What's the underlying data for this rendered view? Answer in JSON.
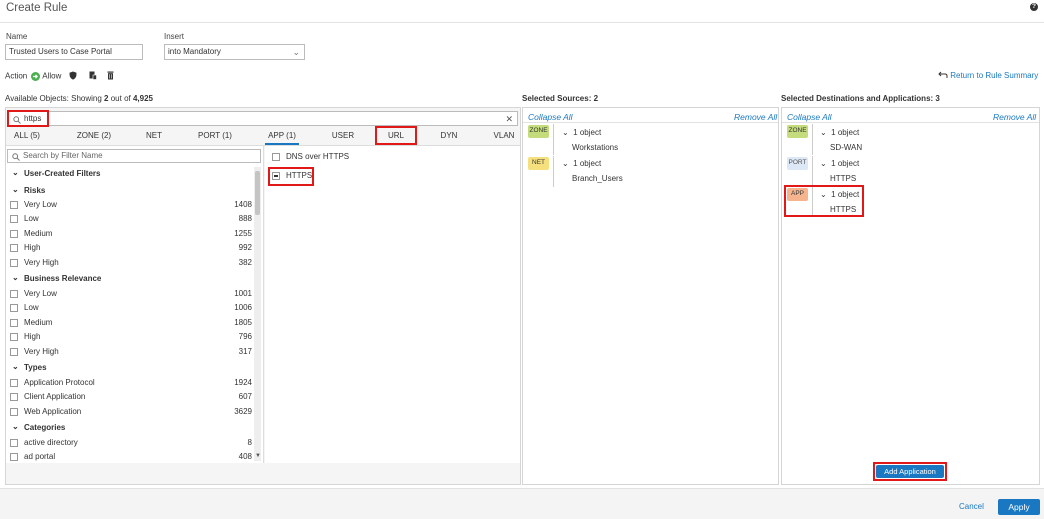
{
  "header": {
    "title": "Create Rule",
    "help_icon": "?"
  },
  "form": {
    "name_label": "Name",
    "name_value": "Trusted Users to Case Portal",
    "insert_label": "Insert",
    "insert_value": "into Mandatory",
    "action_label": "Action",
    "action_value": "Allow",
    "return_link": "Return to Rule Summary"
  },
  "available": {
    "label": "Available Objects: Showing",
    "shown": "2",
    "sep": "out of",
    "total": "4,925",
    "search_value": "https",
    "tabs": [
      "ALL (5)",
      "ZONE (2)",
      "NET",
      "PORT (1)",
      "APP (1)",
      "USER",
      "URL",
      "DYN",
      "VLAN"
    ],
    "filter_placeholder": "Search by Filter Name",
    "filters": {
      "user_created": "User-Created Filters",
      "risks": {
        "title": "Risks",
        "items": [
          {
            "label": "Very Low",
            "count": "1408"
          },
          {
            "label": "Low",
            "count": "888"
          },
          {
            "label": "Medium",
            "count": "1255"
          },
          {
            "label": "High",
            "count": "992"
          },
          {
            "label": "Very High",
            "count": "382"
          }
        ]
      },
      "business": {
        "title": "Business Relevance",
        "items": [
          {
            "label": "Very Low",
            "count": "1001"
          },
          {
            "label": "Low",
            "count": "1006"
          },
          {
            "label": "Medium",
            "count": "1805"
          },
          {
            "label": "High",
            "count": "796"
          },
          {
            "label": "Very High",
            "count": "317"
          }
        ]
      },
      "types": {
        "title": "Types",
        "items": [
          {
            "label": "Application Protocol",
            "count": "1924"
          },
          {
            "label": "Client Application",
            "count": "607"
          },
          {
            "label": "Web Application",
            "count": "3629"
          }
        ]
      },
      "categories": {
        "title": "Categories",
        "items": [
          {
            "label": "active directory",
            "count": "8"
          },
          {
            "label": "ad portal",
            "count": "408"
          }
        ]
      }
    },
    "results": [
      "DNS over HTTPS",
      "HTTPS"
    ]
  },
  "sources": {
    "title": "Selected Sources: 2",
    "collapse": "Collapse All",
    "remove": "Remove All",
    "groups": [
      {
        "badge": "ZONE",
        "summary": "1 object",
        "item": "Workstations"
      },
      {
        "badge": "NET",
        "summary": "1 object",
        "item": "Branch_Users"
      }
    ]
  },
  "destinations": {
    "title": "Selected Destinations and Applications: 3",
    "collapse": "Collapse All",
    "remove": "Remove All",
    "groups": [
      {
        "badge": "ZONE",
        "summary": "1 object",
        "item": "SD-WAN"
      },
      {
        "badge": "PORT",
        "summary": "1 object",
        "item": "HTTPS"
      },
      {
        "badge": "APP",
        "summary": "1 object",
        "item": "HTTPS"
      }
    ],
    "add_button": "Add Application"
  },
  "footer": {
    "cancel": "Cancel",
    "apply": "Apply"
  },
  "colors": {
    "accent": "#1a78c2",
    "highlight": "#e01818",
    "zone": "#c5dc7c",
    "net": "#f6e07e",
    "port": "#dde8f6",
    "app": "#f6b48e"
  },
  "icons": [
    "help-icon",
    "allow-icon",
    "shield-icon",
    "log-icon",
    "delete-icon",
    "return-icon",
    "search-icon",
    "clear-icon",
    "chevron-down-icon"
  ]
}
